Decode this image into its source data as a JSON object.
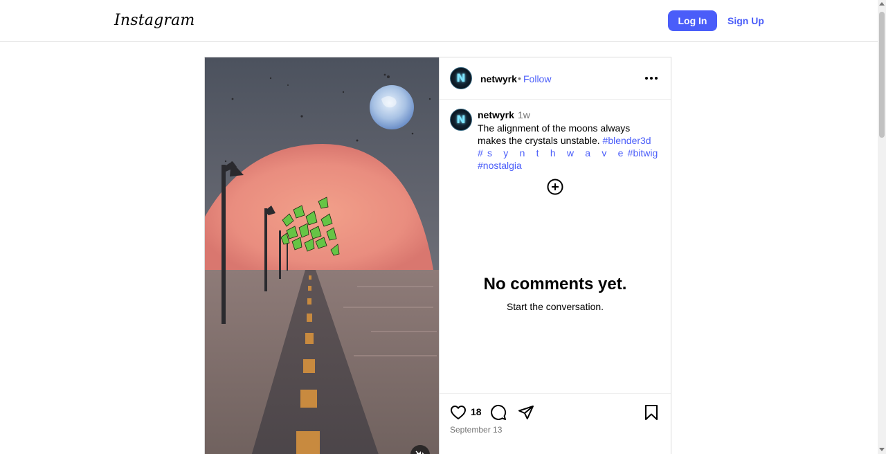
{
  "header": {
    "logo_text": "Instagram",
    "login_label": "Log In",
    "signup_label": "Sign Up",
    "accent_color": "#4a5df9"
  },
  "post": {
    "avatar_letter": "N",
    "username": "netwyrk",
    "separator": "•",
    "follow_label": "Follow",
    "more_icon": "more-horizontal-icon",
    "time_ago": "1w",
    "caption_text": "The alignment of the moons always makes the crystals unstable.",
    "hashtags": [
      "#blender3d",
      "#s y n t h w a v e",
      "#bitwig",
      "#nostalgia"
    ],
    "comments_empty_title": "No comments yet.",
    "comments_empty_subtitle": "Start the conversation.",
    "like_count": "18",
    "date": "September 13",
    "icons": [
      "heart-icon",
      "comment-icon",
      "share-icon",
      "bookmark-icon",
      "add-comment-icon",
      "mute-icon"
    ]
  }
}
